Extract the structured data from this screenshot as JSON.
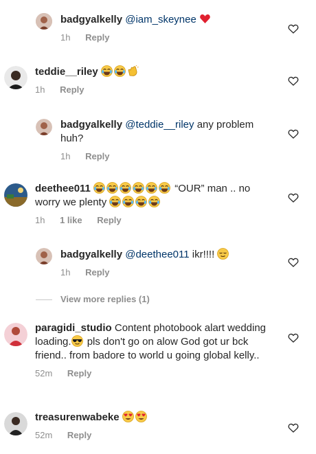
{
  "comments": [
    {
      "user": "badgyalkelly",
      "mention": "@iam_skeynee",
      "text": "",
      "time": "1h",
      "likes": "",
      "reply": "Reply"
    },
    {
      "user": "teddie__riley",
      "mention": "",
      "text": "",
      "time": "1h",
      "likes": "",
      "reply": "Reply"
    },
    {
      "user": "badgyalkelly",
      "mention": "@teddie__riley",
      "text": "any problem huh?",
      "time": "1h",
      "likes": "",
      "reply": "Reply"
    },
    {
      "user": "deethee011",
      "mention": "",
      "text_a": "“OUR” man .. no worry we plenty",
      "time": "1h",
      "likes": "1 like",
      "reply": "Reply"
    },
    {
      "user": "badgyalkelly",
      "mention": "@deethee011",
      "text": "ikr!!!!",
      "time": "1h",
      "likes": "",
      "reply": "Reply"
    },
    {
      "user": "paragidi_studio",
      "mention": "",
      "text_a": "Content photobook alart wedding loading.",
      "text_b": "pls don't go on alow God got ur bck friend.. from badore to world u going global kelly..",
      "time": "52m",
      "likes": "",
      "reply": "Reply"
    },
    {
      "user": "treasurenwabeke",
      "mention": "",
      "text": "",
      "time": "52m",
      "likes": "",
      "reply": "Reply"
    }
  ],
  "view_more": "View more replies (1)",
  "icons": {
    "heart": "heart-outline-icon",
    "laugh": "tears-of-joy-emoji",
    "clap": "clapping-hands-emoji",
    "heart_emoji": "red-heart-emoji",
    "relieved": "relieved-face-emoji",
    "cool": "sunglasses-emoji",
    "hearteyes": "heart-eyes-emoji"
  }
}
